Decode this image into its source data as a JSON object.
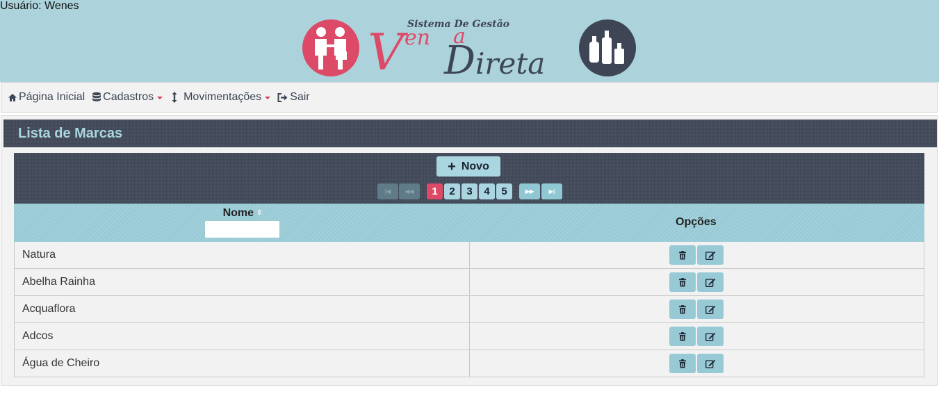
{
  "header": {
    "user_label": "Usuário: Wenes",
    "logo": {
      "top_text": "Sistema De Gestão",
      "word_1": "Venda",
      "word_2": "Direta"
    }
  },
  "nav": {
    "items": [
      {
        "label": "Página Inicial",
        "icon": "home-icon",
        "dropdown": false
      },
      {
        "label": "Cadastros",
        "icon": "database-icon",
        "dropdown": true
      },
      {
        "label": "Movimentações",
        "icon": "vertical-arrows-icon",
        "dropdown": true
      },
      {
        "label": "Sair",
        "icon": "sign-out-icon",
        "dropdown": false
      }
    ]
  },
  "panel": {
    "title": "Lista de Marcas",
    "new_button": "Novo",
    "pager": {
      "pages": [
        "1",
        "2",
        "3",
        "4",
        "5"
      ],
      "active_page": "1",
      "first": "|◀",
      "prev": "◀◀",
      "next": "▶▶",
      "last": "▶|"
    },
    "table": {
      "columns": [
        "Nome",
        "Opções"
      ],
      "rows": [
        "Natura",
        "Abelha Rainha",
        "Acquaflora",
        "Adcos",
        "Água de Cheiro"
      ]
    }
  },
  "colors": {
    "header_bg": "#acd3dc",
    "dark_bar": "#3e4655",
    "accent_light": "#a9d6e0",
    "accent_pink": "#dc4a68"
  }
}
